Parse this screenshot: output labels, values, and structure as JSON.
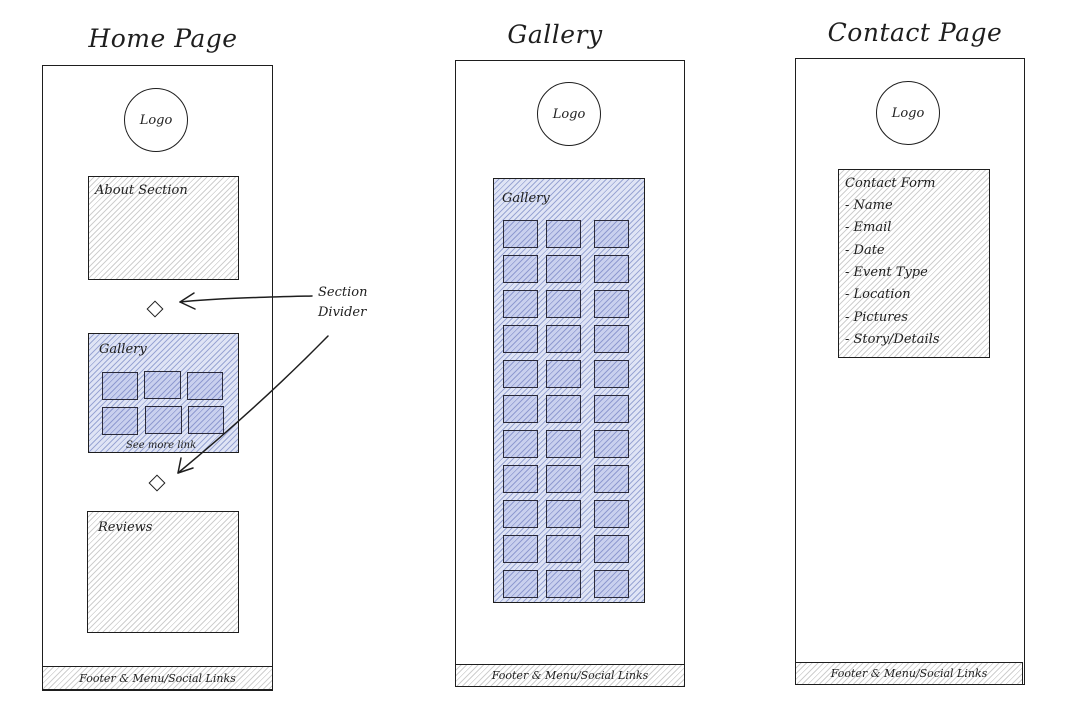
{
  "home": {
    "title": "Home Page",
    "logo": "Logo",
    "about_label": "About Section",
    "gallery_label": "Gallery",
    "see_more": "See more link",
    "reviews_label": "Reviews",
    "footer": "Footer & Menu/Social Links"
  },
  "annotation": {
    "line1": "Section",
    "line2": "Divider"
  },
  "gallery_page": {
    "title": "Gallery",
    "logo": "Logo",
    "gallery_label": "Gallery",
    "footer": "Footer & Menu/Social Links"
  },
  "contact": {
    "title": "Contact Page",
    "logo": "Logo",
    "form_title": "Contact Form",
    "fields": [
      "- Name",
      "- Email",
      "- Date",
      "- Event Type",
      "- Location",
      "- Pictures",
      "- Story/Details"
    ],
    "footer": "Footer & Menu/Social Links"
  }
}
